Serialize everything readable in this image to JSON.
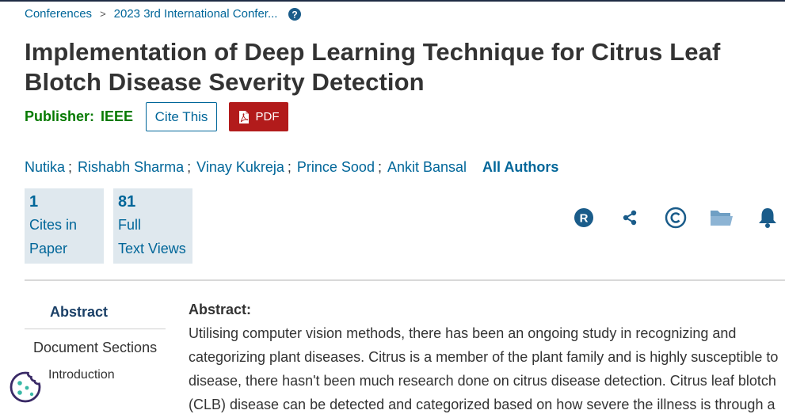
{
  "breadcrumb": {
    "items": [
      "Conferences",
      "2023 3rd International Confer..."
    ],
    "separator": ">",
    "help_icon": "question-circle-icon"
  },
  "title": "Implementation of Deep Learning Technique for Citrus Leaf Blotch Disease Severity Detection",
  "publisher": {
    "label": "Publisher:",
    "name": "IEEE"
  },
  "buttons": {
    "cite": "Cite This",
    "pdf": "PDF",
    "pdf_icon": "pdf-file-icon"
  },
  "authors": {
    "list": [
      "Nutika",
      "Rishabh Sharma",
      "Vinay Kukreja",
      "Prince Sood",
      "Ankit Bansal"
    ],
    "separator": ";",
    "all_label": "All Authors"
  },
  "metrics": [
    {
      "number": "1",
      "line1": "Cites in",
      "line2": "Paper"
    },
    {
      "number": "81",
      "line1": "Full",
      "line2": "Text Views"
    }
  ],
  "action_icons": [
    "rights-r-icon",
    "share-icon",
    "copyright-icon",
    "folder-icon",
    "bell-icon"
  ],
  "nav": {
    "abstract": "Abstract",
    "document_sections": "Document Sections",
    "introduction": "Introduction"
  },
  "abstract": {
    "heading": "Abstract:",
    "text": "Utilising computer vision methods, there has been an ongoing study in recognizing and categorizing plant diseases. Citrus is a member of the plant family and is highly susceptible to disease, there hasn't been much research done on citrus disease detection. Citrus leaf blotch (CLB) disease can be detected and categorized based on how severe the illness is through a"
  },
  "colors": {
    "link": "#006699",
    "publisher": "#067a00",
    "pdf_button": "#b21b1b",
    "metric_bg": "#dfe8ee",
    "icon": "#1a5c8a"
  }
}
